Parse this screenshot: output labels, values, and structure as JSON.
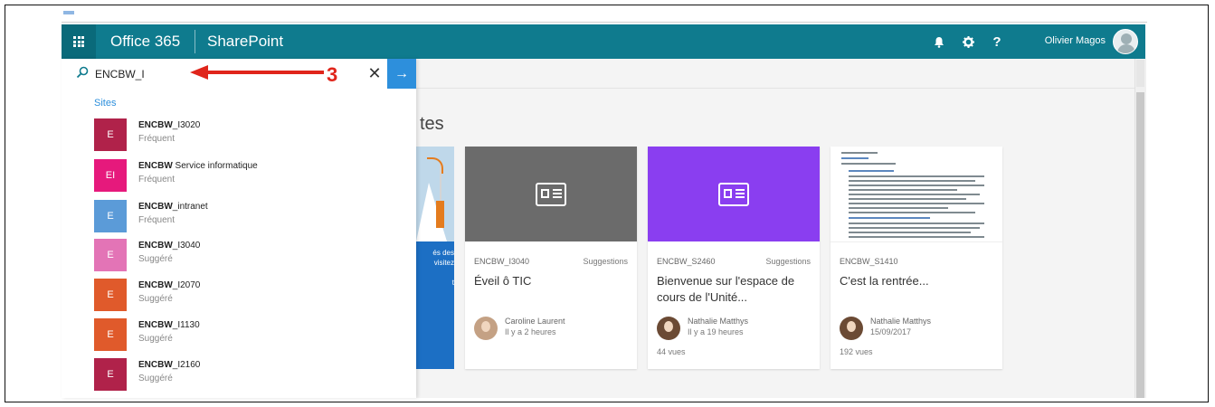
{
  "suite_bar": {
    "brand": "Office 365",
    "app": "SharePoint",
    "user_name": "Olivier Magos",
    "icons": [
      "bell-icon",
      "gear-icon",
      "help-icon"
    ],
    "help_label": "?",
    "color": "#0f7b8e"
  },
  "search": {
    "value": "ENCBW_I",
    "clear_label": "✕",
    "go_label": "→"
  },
  "results": {
    "section_label": "Sites",
    "items": [
      {
        "initials": "E",
        "prefix": "ENCBW",
        "rest": "_I3020",
        "sub": "Fréquent",
        "color": "#b0224a"
      },
      {
        "initials": "EI",
        "prefix": "ENCBW",
        "rest": " Service informatique",
        "sub": "Fréquent",
        "color": "#e6197c"
      },
      {
        "initials": "E",
        "prefix": "ENCBW",
        "rest": "_intranet",
        "sub": "Fréquent",
        "color": "#5b9bd8"
      },
      {
        "initials": "E",
        "prefix": "ENCBW",
        "rest": "_I3040",
        "sub": "Suggéré",
        "color": "#e374b6"
      },
      {
        "initials": "E",
        "prefix": "ENCBW",
        "rest": "_I2070",
        "sub": "Suggéré",
        "color": "#e05a2b"
      },
      {
        "initials": "E",
        "prefix": "ENCBW",
        "rest": "_I1130",
        "sub": "Suggéré",
        "color": "#e05a2b"
      },
      {
        "initials": "E",
        "prefix": "ENCBW",
        "rest": "_I2160",
        "sub": "Suggéré",
        "color": "#b0224a"
      }
    ]
  },
  "main": {
    "section_title_fragment": "tes",
    "promo_text": "és des\n visitez\n\nt",
    "cards": [
      {
        "site": "ENCBW_I3040",
        "tag": "Suggestions",
        "title": "Éveil ô TIC",
        "author": "Caroline Laurent",
        "time": "Il y a 2 heures",
        "views": "",
        "thumb_color": "#6b6b6b"
      },
      {
        "site": "ENCBW_S2460",
        "tag": "Suggestions",
        "title": "Bienvenue sur l'espace de cours de l'Unité...",
        "author": "Nathalie Matthys",
        "time": "Il y a 19 heures",
        "views": "44 vues",
        "thumb_color": "#8a3ef0"
      },
      {
        "site": "ENCBW_S1410",
        "tag": "",
        "title": "C'est la rentrée...",
        "author": "Nathalie Matthys",
        "time": "15/09/2017",
        "views": "192 vues",
        "thumb_color": "#ffffff"
      }
    ]
  },
  "annotation": {
    "number": "3",
    "color": "#e0251b"
  }
}
